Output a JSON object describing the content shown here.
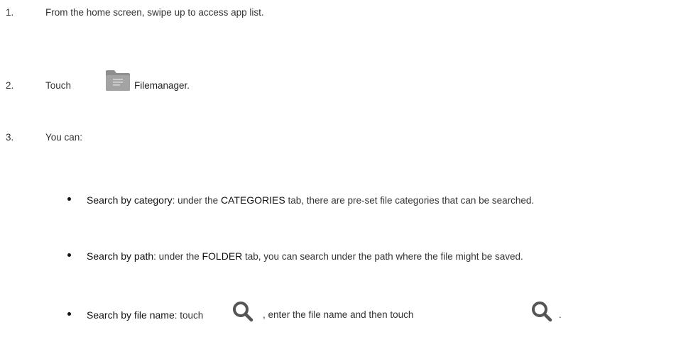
{
  "steps": [
    {
      "number": "1.",
      "text": "From the home screen, swipe up to access app list."
    },
    {
      "number": "2.",
      "prefix": "Touch",
      "app_name": "Filemanager",
      "suffix": "."
    },
    {
      "number": "3.",
      "text": "You can:"
    }
  ],
  "bullets": [
    {
      "label": "Search by category",
      "parts": [
        ": under the ",
        "CATEGORIES",
        " tab, there are pre-set file categories that can be searched."
      ]
    },
    {
      "label": "Search by path",
      "parts": [
        ": under the ",
        "FOLDER",
        " tab, you can search under the path where the file might be saved."
      ]
    },
    {
      "label": "Search by file name",
      "parts": [
        ": touch",
        ", enter the file name and then touch",
        "."
      ]
    }
  ],
  "icons": {
    "folder": "folder-icon",
    "search": "search-icon"
  },
  "colors": {
    "text": "#333333",
    "icon_gray": "#555555",
    "folder_gray": "#8a8a8a"
  }
}
